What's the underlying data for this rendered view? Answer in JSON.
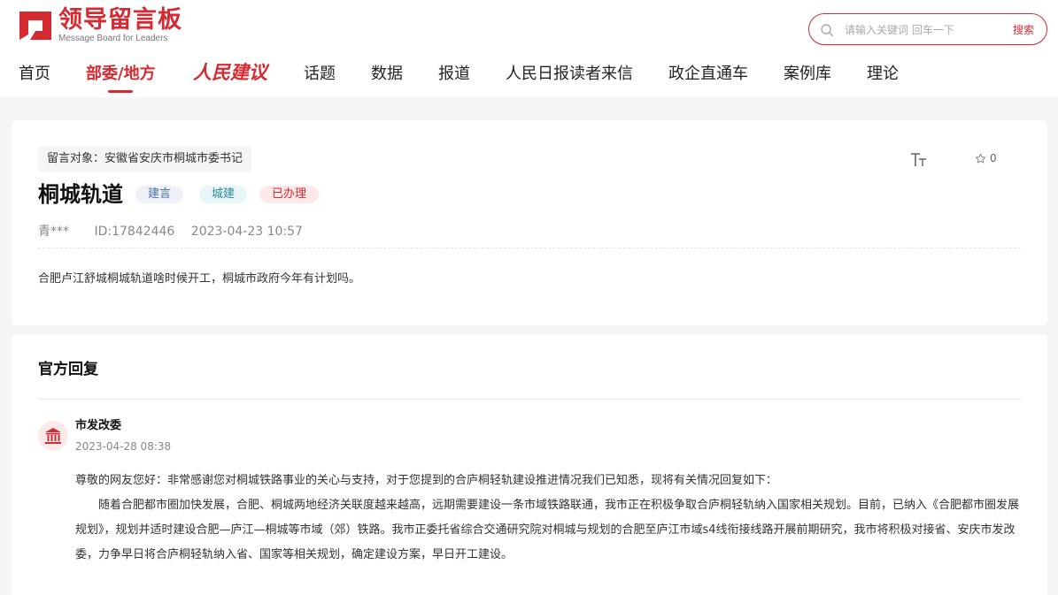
{
  "header": {
    "logo": {
      "cn": "领导留言板",
      "en": "Message Board for Leaders"
    },
    "search": {
      "placeholder": "请输入关键词 回车一下",
      "button_label": "搜索"
    },
    "nav": [
      {
        "label": "首页",
        "active": false
      },
      {
        "label": "部委/地方",
        "active": true
      },
      {
        "label": "人民建议",
        "active": false
      },
      {
        "label": "话题",
        "active": false
      },
      {
        "label": "数据",
        "active": false
      },
      {
        "label": "报道",
        "active": false
      },
      {
        "label": "人民日报读者来信",
        "active": false
      },
      {
        "label": "政企直通车",
        "active": false
      },
      {
        "label": "案例库",
        "active": false
      },
      {
        "label": "理论",
        "active": false
      }
    ]
  },
  "message": {
    "target": "留言对象：安徽省安庆市桐城市委书记",
    "title": "桐城轨道",
    "tags": [
      "建言",
      "城建",
      "已办理"
    ],
    "author": "青***",
    "id_label": "ID:17842446",
    "datetime": "2023-04-23 10:57",
    "star_count": "0",
    "content": "合肥卢江舒城桐城轨道啥时候开工，桐城市政府今年有计划吗。"
  },
  "reply": {
    "section_title": "官方回复",
    "department": "市发改委",
    "datetime": "2023-04-28 08:38",
    "greeting": "尊敬的网友您好：非常感谢您对桐城铁路事业的关心与支持，对于您提到的合庐桐轻轨建设推进情况我们已知悉，现将有关情况回复如下：",
    "body": "随着合肥都市圈加快发展，合肥、桐城两地经济关联度越来越高，远期需要建设一条市域铁路联通，我市正在积极争取合庐桐轻轨纳入国家相关规划。目前，已纳入《合肥都市圈发展规划》，规划并适时建设合肥—庐江—桐城等市域（郊）铁路。我市正委托省综合交通研究院对桐城与规划的合肥至庐江市域s4线衔接线路开展前期研究，我市将积极对接省、安庆市发改委，力争早日将合庐桐轻轨纳入省、国家等相关规划，确定建设方案，早日开工建设。"
  },
  "colors": {
    "brand": "#d62a32",
    "background": "#f5f5f5"
  }
}
